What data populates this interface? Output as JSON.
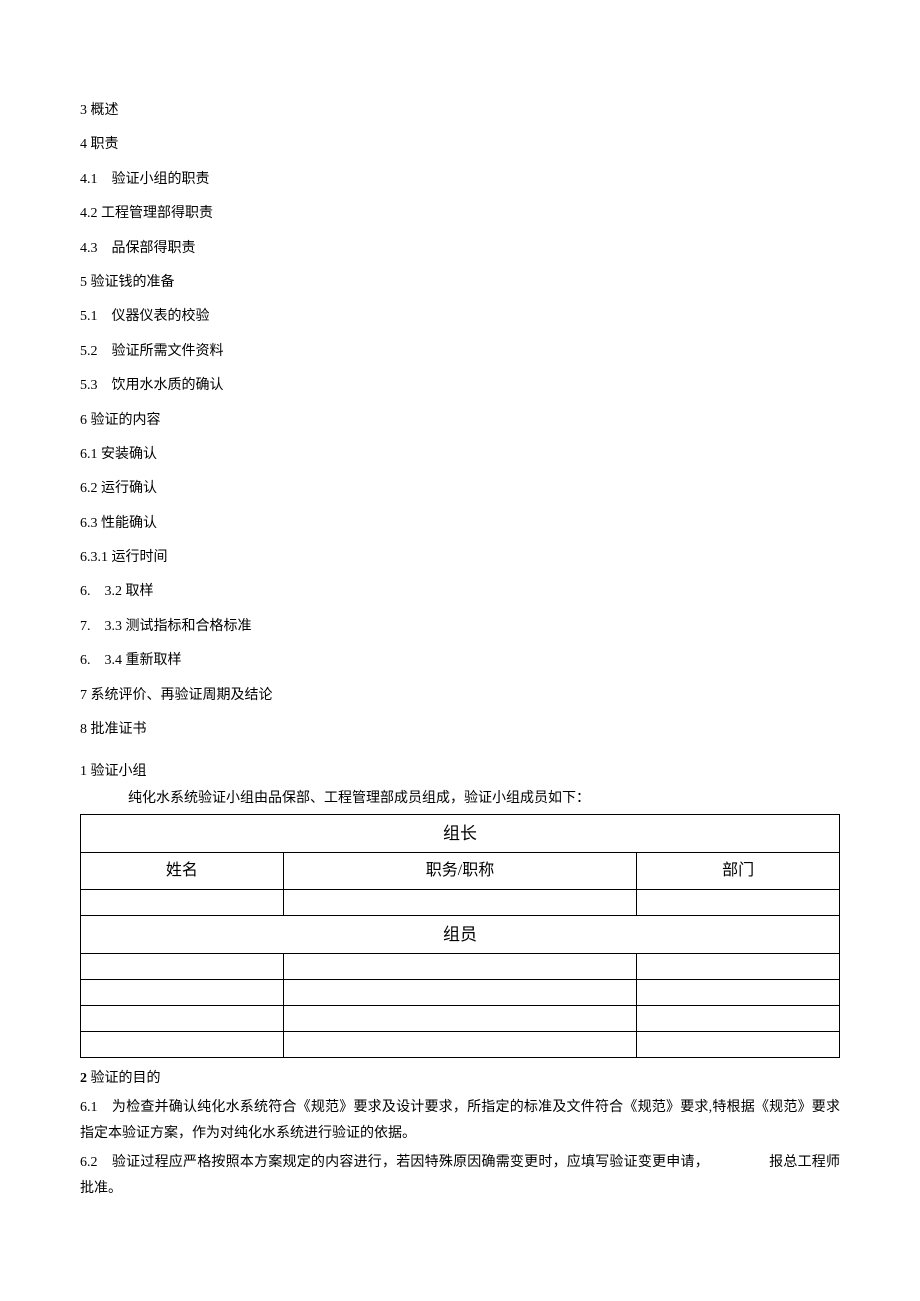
{
  "toc": [
    "3 概述",
    "4 职责",
    "4.1　验证小组的职责",
    "4.2 工程管理部得职责",
    "4.3　品保部得职责",
    "5 验证钱的准备",
    "5.1　仪器仪表的校验",
    "5.2　验证所需文件资料",
    "5.3　饮用水水质的确认",
    "6 验证的内容",
    "6.1 安装确认",
    "6.2 运行确认",
    "6.3 性能确认",
    "6.3.1 运行时间",
    "6.　3.2 取样",
    "7.　3.3 测试指标和合格标准",
    "6.　3.4 重新取样",
    "7 系统评价、再验证周期及结论",
    "8 批准证书"
  ],
  "section1": {
    "title": "1 验证小组",
    "intro": "纯化水系统验证小组由品保部、工程管理部成员组成，验证小组成员如下：",
    "table": {
      "leader_header": "组长",
      "col_name": "姓名",
      "col_position": "职务/职称",
      "col_dept": "部门",
      "member_header": "组员"
    }
  },
  "section2": {
    "title_bold": "2",
    "title_rest": " 验证的目的",
    "para1_prefix": "6.1　为检查并确认纯化水系统符合《规范》要求及设计要求，所指定的标准及文件符合《规范》要求,特根据《规范》要求指定本验证方案，作为对纯化水系统进行验证的依据。",
    "para2_prefix": "6.2　验证过程应严格按照本方案规定的内容进行，若因特殊原因确需变更时，应填写验证变更申请，",
    "para2_suffix": "报总工程师批准。"
  }
}
